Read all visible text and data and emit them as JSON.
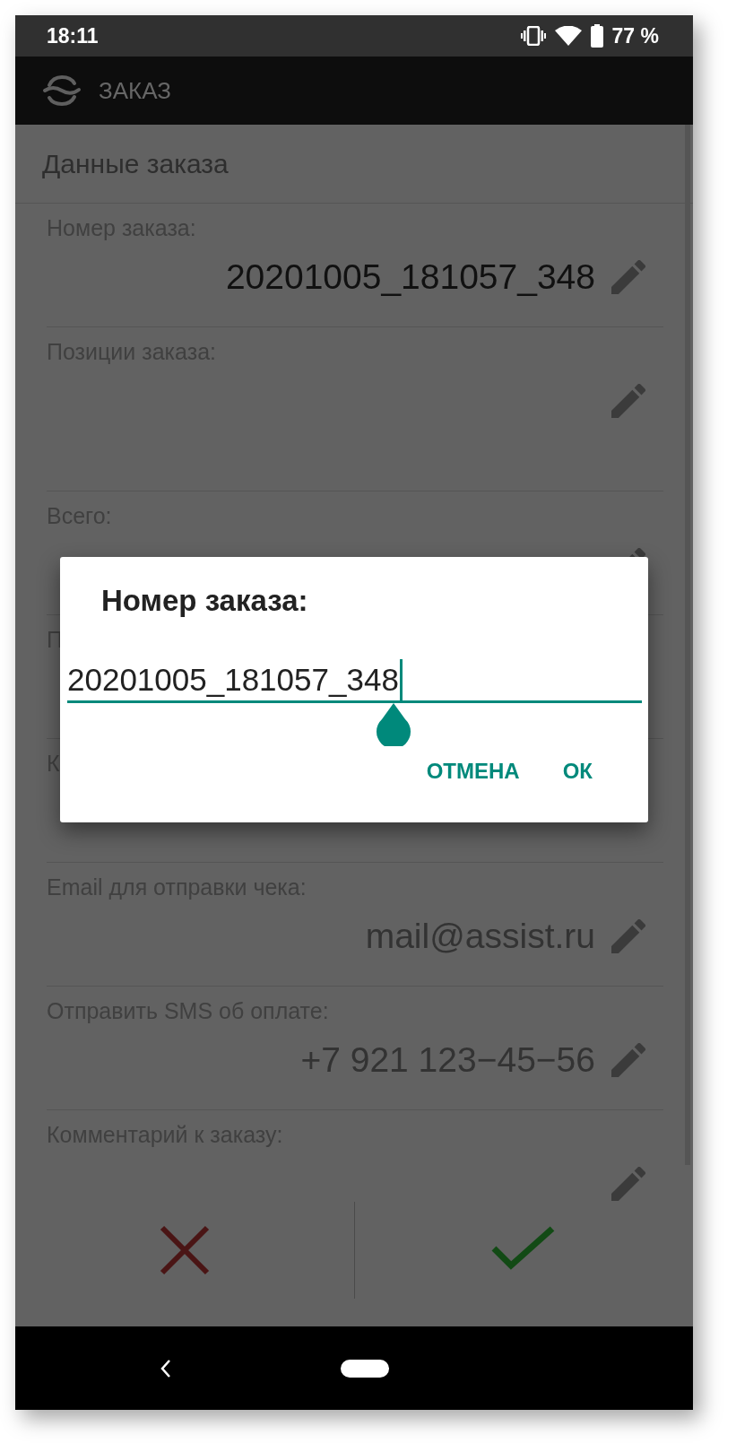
{
  "status_bar": {
    "time": "18:11",
    "battery": "77 %"
  },
  "app_bar": {
    "title": "ЗАКАЗ"
  },
  "section": {
    "title": "Данные заказа"
  },
  "fields": [
    {
      "kind": "single",
      "label": "Номер заказа:",
      "value": "20201005_181057_348",
      "highlighted": true,
      "editable": true
    },
    {
      "kind": "multiline",
      "label": "Позиции заказа:",
      "editable": true
    },
    {
      "kind": "single",
      "label": "Всего:",
      "editable": true
    },
    {
      "kind": "single",
      "label": "П"
    },
    {
      "kind": "single",
      "label": "К"
    },
    {
      "kind": "single",
      "label": "Email для отправки чека:",
      "value": "mail@assist.ru",
      "highlighted": false,
      "editable": true
    },
    {
      "kind": "single",
      "label": "Отправить SMS об оплате:",
      "value": "+7 921 123−45−56",
      "highlighted": false,
      "editable": true
    },
    {
      "kind": "single",
      "label": "Комментарий к заказу:",
      "editable": true
    }
  ],
  "dialog": {
    "title": "Номер заказа:",
    "input": {
      "value": "20201005_181057_348"
    },
    "buttons": [
      "ОТМЕНА",
      "ОК"
    ]
  }
}
